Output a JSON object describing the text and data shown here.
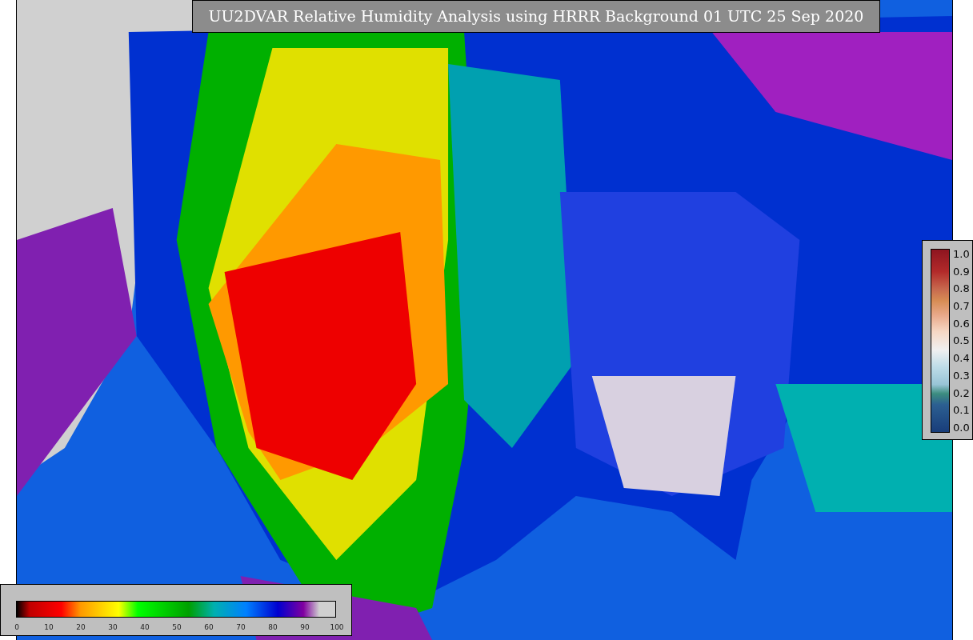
{
  "title": "UU2DVAR Relative Humidity Analysis using HRRR Background 01 UTC 25 Sep 2020",
  "analysis_colorbar": {
    "ticks": [
      "1.0",
      "0.9",
      "0.8",
      "0.7",
      "0.6",
      "0.5",
      "0.4",
      "0.3",
      "0.2",
      "0.1",
      "0.0"
    ]
  },
  "humidity_colorbar": {
    "ticks": [
      "0",
      "10",
      "20",
      "30",
      "40",
      "50",
      "60",
      "70",
      "80",
      "90",
      "100"
    ]
  }
}
